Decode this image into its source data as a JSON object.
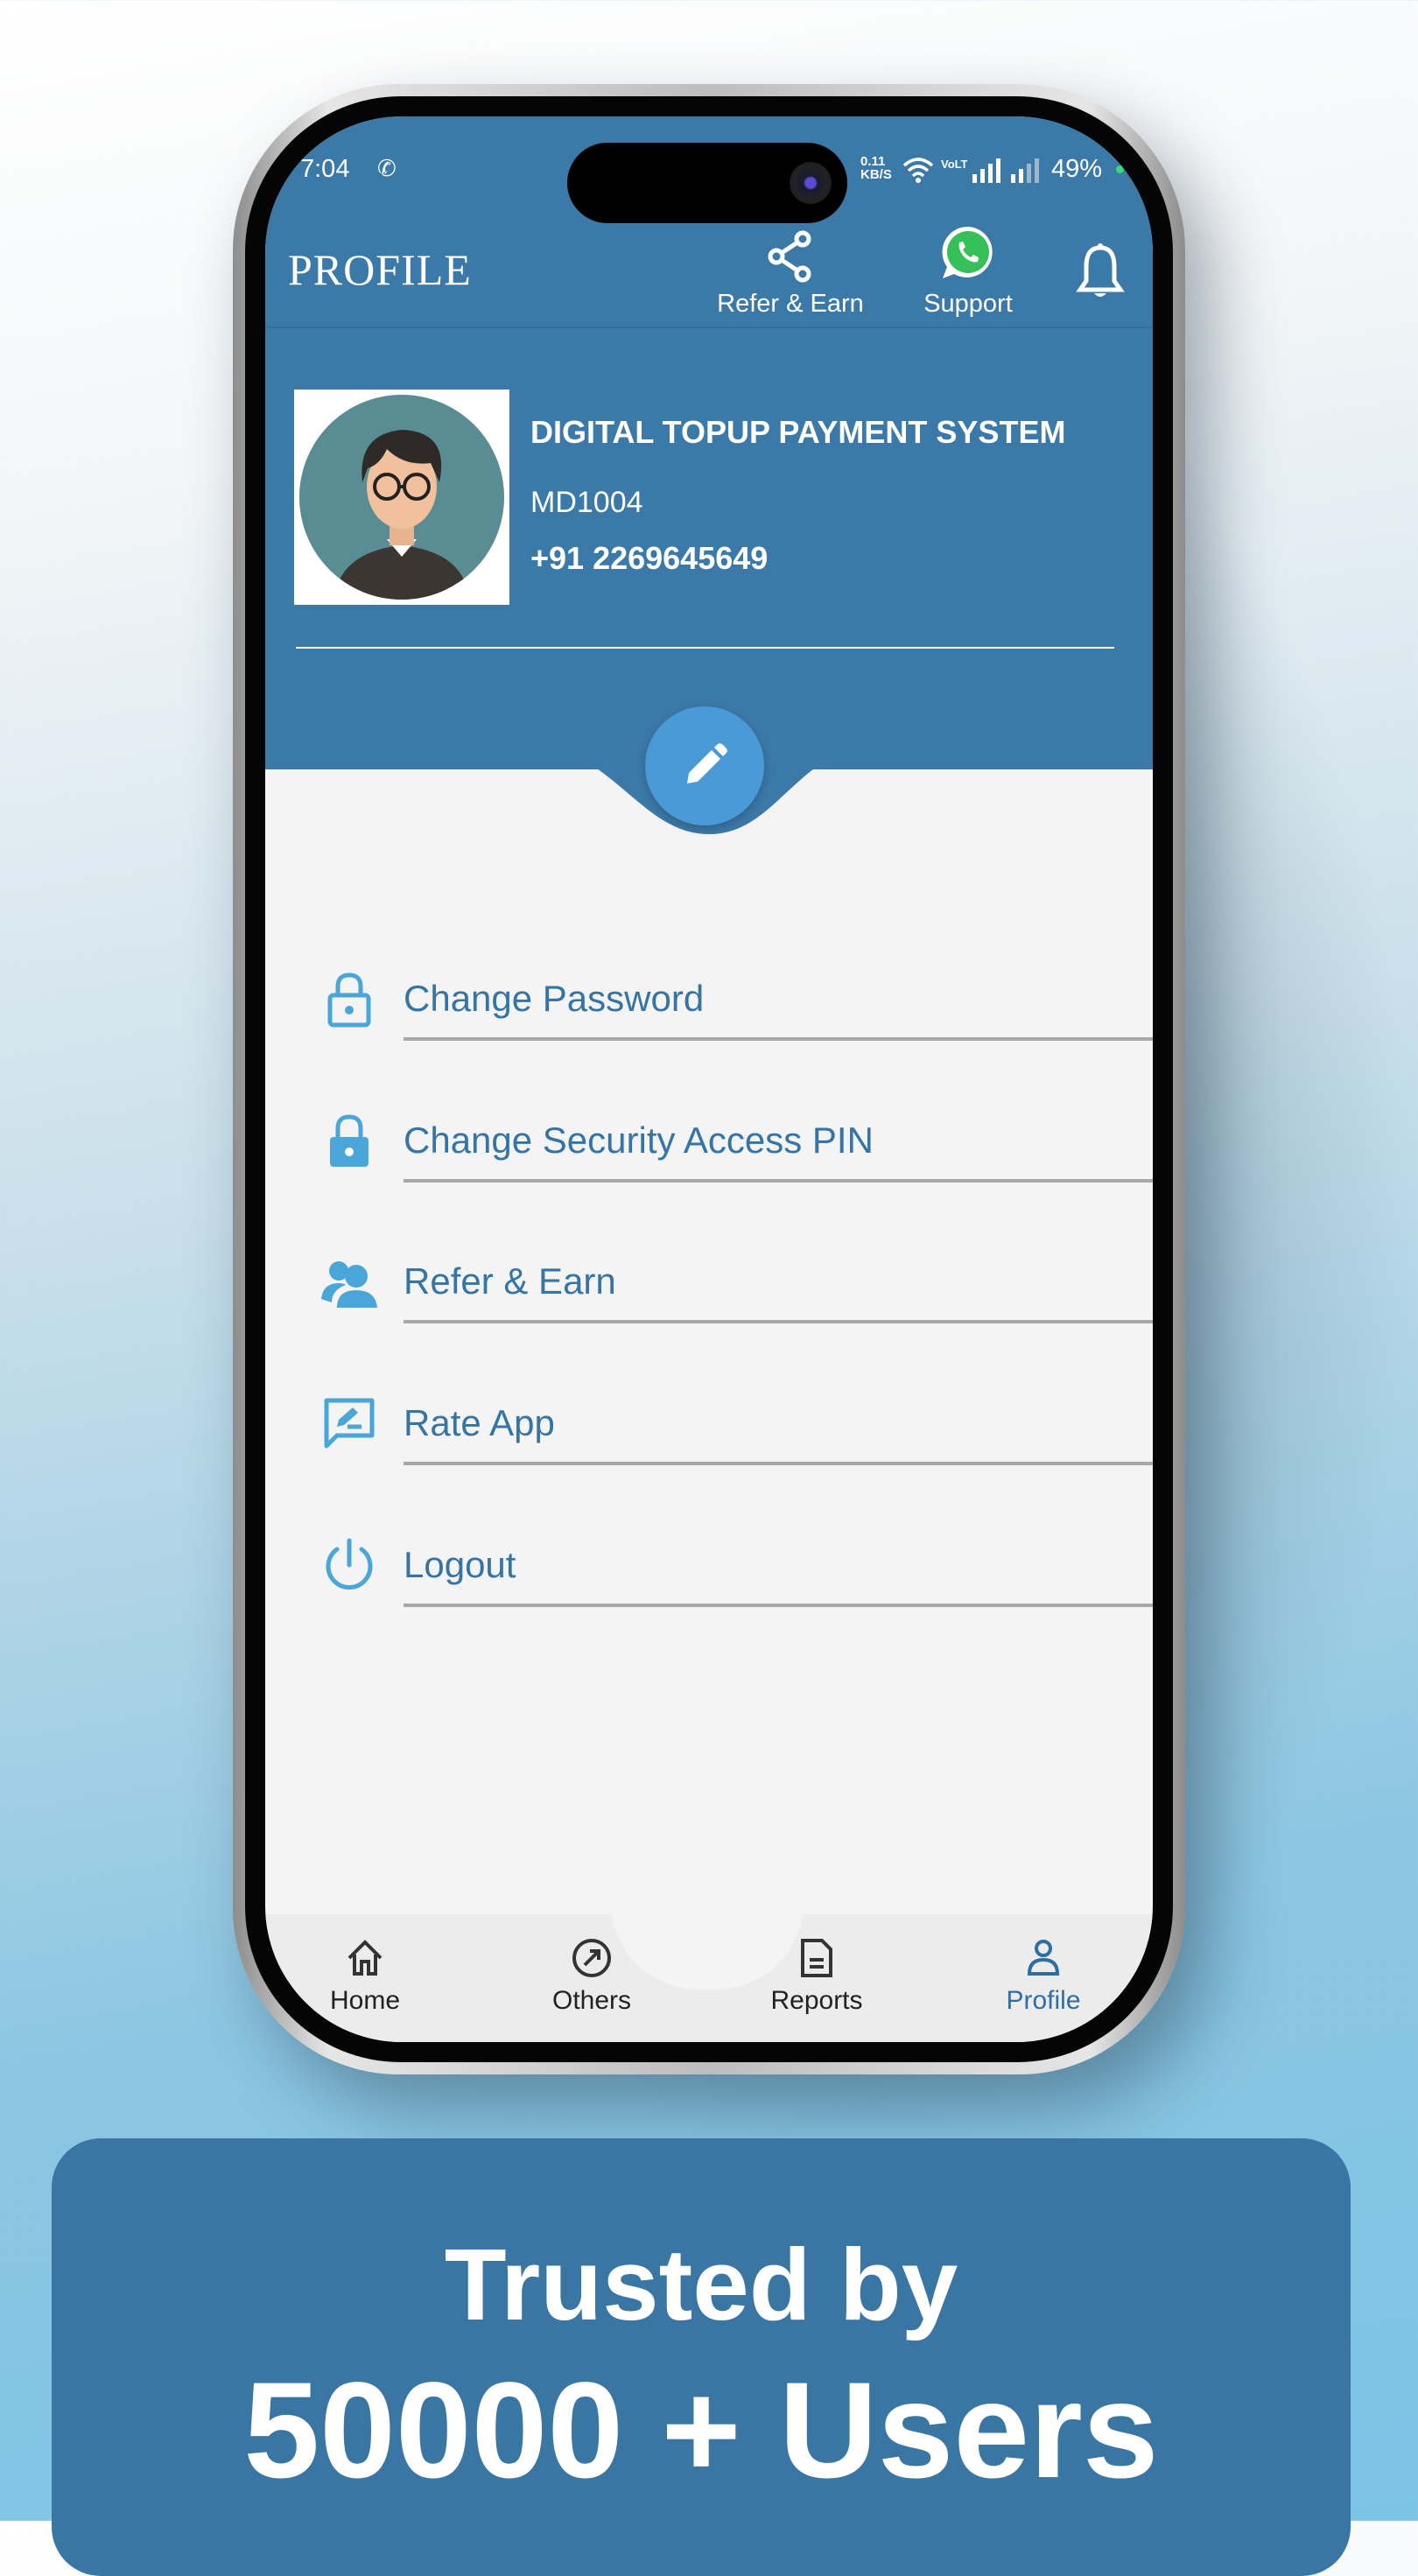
{
  "status": {
    "time": "7:04",
    "net_speed": "0.11",
    "net_unit": "KB/S",
    "volte": "VoLTE",
    "battery": "49%"
  },
  "header": {
    "title": "PROFILE",
    "refer_label": "Refer & Earn",
    "support_label": "Support"
  },
  "profile": {
    "name": "DIGITAL TOPUP PAYMENT SYSTEM",
    "id": "MD1004",
    "phone": "+91 2269645649"
  },
  "menu": [
    {
      "label": "Change Password",
      "icon": "lock-outline-icon"
    },
    {
      "label": "Change Security Access PIN",
      "icon": "lock-icon"
    },
    {
      "label": "Refer & Earn",
      "icon": "users-icon"
    },
    {
      "label": "Rate App",
      "icon": "feedback-icon"
    },
    {
      "label": "Logout",
      "icon": "power-icon"
    }
  ],
  "nav": [
    {
      "label": "Home"
    },
    {
      "label": "Others"
    },
    {
      "label": "Reports"
    },
    {
      "label": "Profile",
      "active": true
    }
  ],
  "banner": {
    "line1": "Trusted by",
    "line2": "50000 + Users"
  },
  "colors": {
    "primary": "#3b79a8",
    "accent": "#4a9ad8",
    "menu_text": "#3574a4",
    "icon": "#4aa6d8"
  }
}
